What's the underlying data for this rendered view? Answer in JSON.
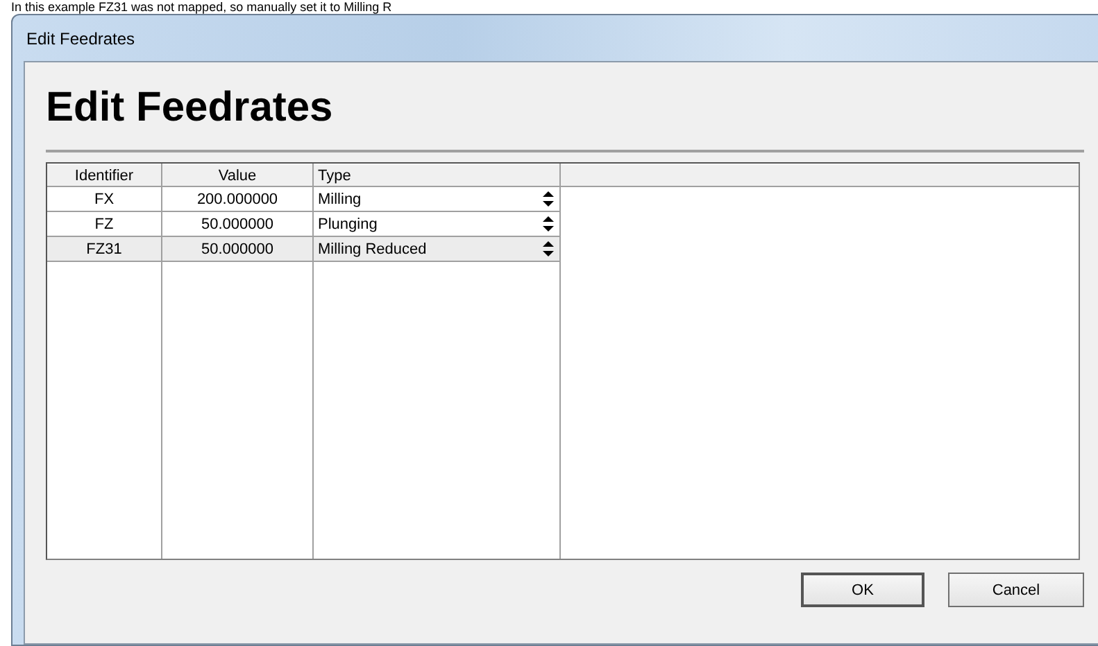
{
  "caption": "In this example FZ31 was not mapped, so manually set it to Milling R",
  "window": {
    "title": "Edit Feedrates"
  },
  "heading": "Edit Feedrates",
  "table": {
    "columns": [
      "Identifier",
      "Value",
      "Type"
    ],
    "rows": [
      {
        "identifier": "FX",
        "value": "200.000000",
        "type": "Milling",
        "selected": false
      },
      {
        "identifier": "FZ",
        "value": "50.000000",
        "type": "Plunging",
        "selected": false
      },
      {
        "identifier": "FZ31",
        "value": "50.000000",
        "type": "Milling Reduced",
        "selected": true
      }
    ]
  },
  "buttons": [
    "OK",
    "Cancel"
  ]
}
